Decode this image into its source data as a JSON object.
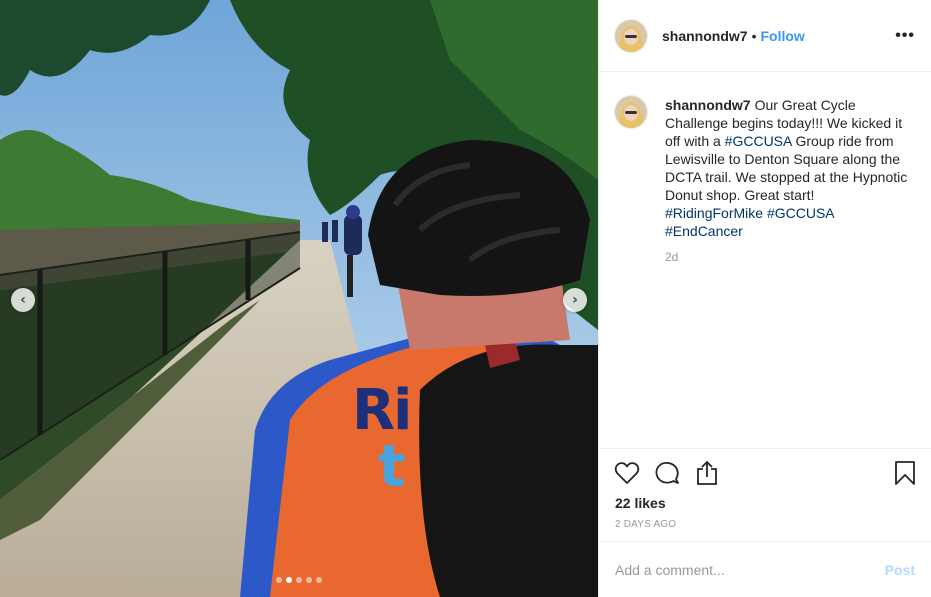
{
  "photo": {
    "jersey_letters": "Ri",
    "jersey_letter2": "t",
    "carousel_total": 5,
    "carousel_active": 2,
    "prev_icon": "chevron-left-icon",
    "next_icon": "chevron-right-icon"
  },
  "header": {
    "username": "shannondw7",
    "separator": "•",
    "follow_label": "Follow",
    "more_glyph": "•••"
  },
  "caption": {
    "username": "shannondw7",
    "text_1": "Our Great Cycle Challenge begins today!!! We kicked it off with a ",
    "tag_1": "#GCCUSA",
    "text_2": " Group ride from Lewisville to Denton Square along the DCTA trail. We stopped at the Hypnotic Donut shop. Great start! ",
    "tag_2": "#RidingForMike",
    "text_3": " ",
    "tag_3": "#GCCUSA",
    "text_4": " ",
    "tag_4": "#EndCancer",
    "time_ago": "2d"
  },
  "actions": {
    "like_icon": "heart-icon",
    "comment_icon": "comment-icon",
    "share_icon": "share-icon",
    "save_icon": "bookmark-icon"
  },
  "likes": "22 likes",
  "date": "2 DAYS AGO",
  "add_comment": {
    "placeholder": "Add a comment...",
    "post_label": "Post"
  },
  "colors": {
    "link": "#3897f0",
    "hashtag": "#003569",
    "muted": "#999999",
    "post_disabled": "#b3dbff"
  }
}
